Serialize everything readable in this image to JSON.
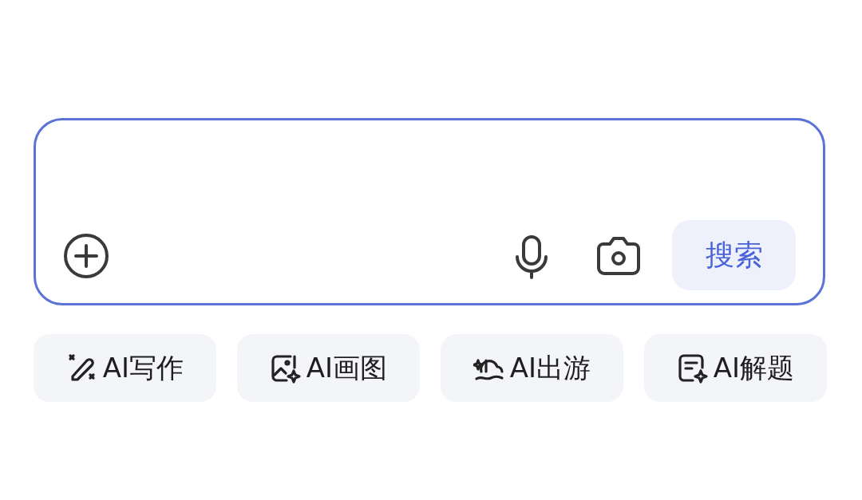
{
  "search_box": {
    "search_button": "搜索"
  },
  "shortcuts": [
    {
      "kind": "write",
      "label": "AI写作"
    },
    {
      "kind": "draw",
      "label": "AI画图"
    },
    {
      "kind": "travel",
      "label": "AI出游"
    },
    {
      "kind": "solve",
      "label": "AI解题"
    }
  ]
}
